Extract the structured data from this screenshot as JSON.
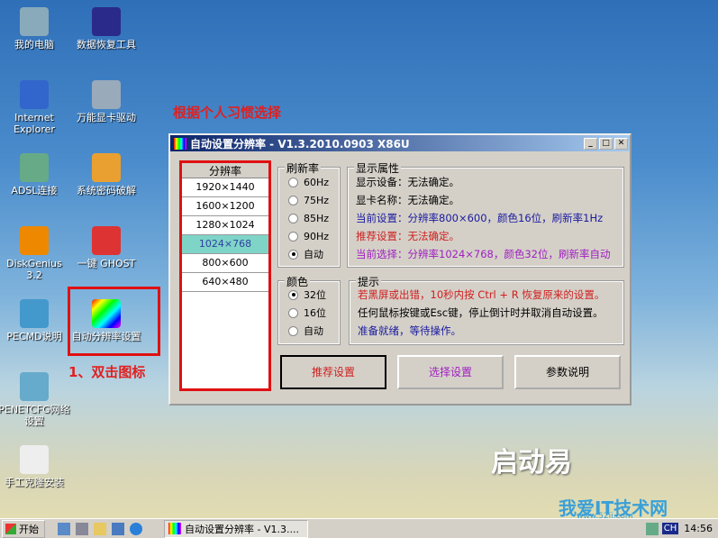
{
  "desktop": {
    "left": [
      "我的电脑",
      "Internet Explorer",
      "ADSL连接",
      "DiskGenius 3.2",
      "PECMD说明",
      "PENETCFG网络设置",
      "手工克隆安装"
    ],
    "right": [
      "数据恢复工具",
      "万能显卡驱动",
      "系统密码破解",
      "一键 GHOST",
      "自动分辨率设置"
    ]
  },
  "annotations": {
    "choose": "根据个人习惯选择",
    "step1": "1、双击图标"
  },
  "window": {
    "title": "自动设置分辨率 - V1.3.2010.0903 X86U",
    "res_header": "分辨率",
    "resolutions": [
      "1920×1440",
      "1600×1200",
      "1280×1024",
      "1024×768",
      "800×600",
      "640×480"
    ],
    "selected_resolution": "1024×768",
    "refresh_label": "刷新率",
    "refresh": [
      "60Hz",
      "75Hz",
      "85Hz",
      "90Hz",
      "自动"
    ],
    "refresh_selected": "自动",
    "color_label": "颜色",
    "colors": [
      "32位",
      "16位",
      "自动"
    ],
    "color_selected": "32位",
    "display_label": "显示属性",
    "display": [
      {
        "text": "显示设备：无法确定。",
        "color": "#000000"
      },
      {
        "text": "显卡名称：无法确定。",
        "color": "#000000"
      },
      {
        "text": "当前设置：分辨率800×600，颜色16位，刷新率1Hz",
        "color": "#1a1aa0"
      },
      {
        "text": "推荐设置：无法确定。",
        "color": "#d02020"
      },
      {
        "text": "当前选择：分辨率1024×768，颜色32位，刷新率自动",
        "color": "#a020c0"
      }
    ],
    "tips_label": "提示",
    "tips": [
      {
        "text": "若黑屏或出错，10秒内按 Ctrl + R 恢复原来的设置。",
        "color": "#d02020"
      },
      {
        "text": "任何鼠标按键或Esc键，停止倒计时并取消自动设置。",
        "color": "#000000"
      },
      {
        "text": "准备就绪，等待操作。",
        "color": "#1a1aa0"
      }
    ],
    "buttons": [
      {
        "label": "推荐设置",
        "color": "#d02020"
      },
      {
        "label": "选择设置",
        "color": "#a020c0"
      },
      {
        "label": "参数说明",
        "color": "#000000"
      }
    ]
  },
  "logo": {
    "text": "启动易",
    "watermark": "我爱IT技术网",
    "url": "www.52ij.com"
  },
  "taskbar": {
    "start": "开始",
    "task": "自动设置分辨率 - V1.3....",
    "lang": "CH",
    "clock": "14:56"
  }
}
